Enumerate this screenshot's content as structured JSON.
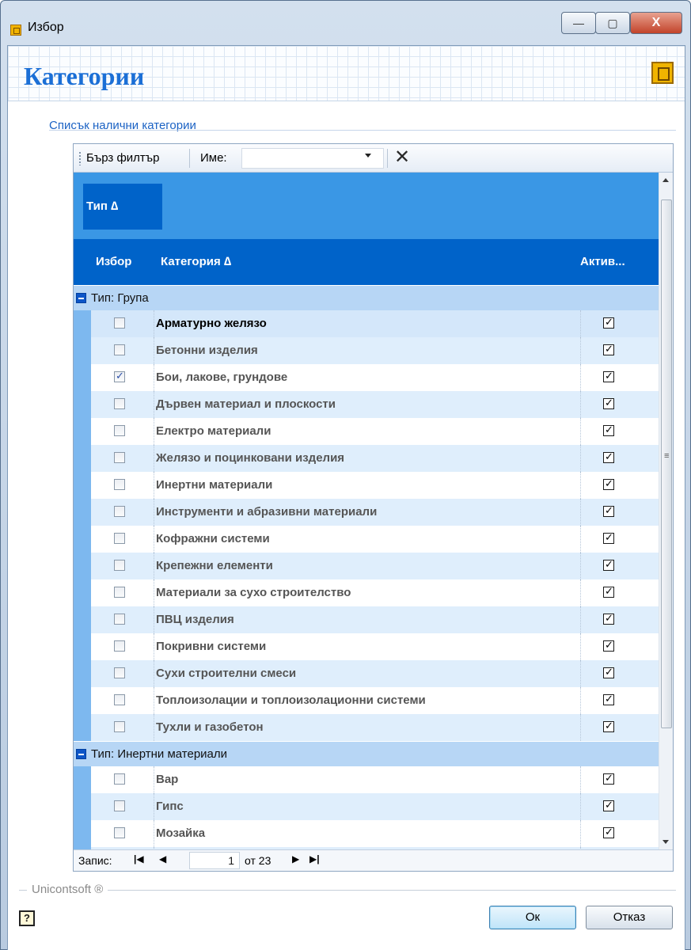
{
  "window": {
    "title": "Избор",
    "min_glyph": "—",
    "max_glyph": "▢",
    "close_glyph": "X"
  },
  "header": {
    "title": "Категории"
  },
  "section": {
    "label": "Списък налични категории"
  },
  "toolbar": {
    "quick_filter": "Бърз филтър",
    "name_label": "Име:",
    "name_value": "",
    "clear_glyph": "✕"
  },
  "grid": {
    "group_by_header": "Тип ∆",
    "columns": {
      "select": "Избор",
      "category": "Категория ∆",
      "active": "Актив..."
    },
    "groups": [
      {
        "label": "Тип: Група",
        "rows": [
          {
            "name": "Арматурно желязо",
            "selected": false,
            "active": true
          },
          {
            "name": "Бетонни изделия",
            "selected": false,
            "active": true
          },
          {
            "name": "Бои, лакове, грундове",
            "selected": true,
            "active": true
          },
          {
            "name": "Дървен материал и плоскости",
            "selected": false,
            "active": true
          },
          {
            "name": "Електро материали",
            "selected": false,
            "active": true
          },
          {
            "name": "Желязо и поцинковани изделия",
            "selected": false,
            "active": true
          },
          {
            "name": "Инертни материали",
            "selected": false,
            "active": true
          },
          {
            "name": "Инструменти и абразивни материали",
            "selected": false,
            "active": true
          },
          {
            "name": "Кофражни системи",
            "selected": false,
            "active": true
          },
          {
            "name": "Крепежни елементи",
            "selected": false,
            "active": true
          },
          {
            "name": "Материали за сухо строителство",
            "selected": false,
            "active": true
          },
          {
            "name": "ПВЦ изделия",
            "selected": false,
            "active": true
          },
          {
            "name": "Покривни системи",
            "selected": false,
            "active": true
          },
          {
            "name": "Сухи строителни смеси",
            "selected": false,
            "active": true
          },
          {
            "name": "Топлоизолации и топлоизолационни системи",
            "selected": false,
            "active": true
          },
          {
            "name": "Тухли и газобетон",
            "selected": false,
            "active": true
          }
        ]
      },
      {
        "label": "Тип: Инертни материали",
        "rows": [
          {
            "name": "Вар",
            "selected": false,
            "active": true
          },
          {
            "name": "Гипс",
            "selected": false,
            "active": true
          },
          {
            "name": "Мозайка",
            "selected": false,
            "active": true
          },
          {
            "name": "",
            "selected": false,
            "active": false
          }
        ]
      }
    ]
  },
  "navigator": {
    "label": "Запис:",
    "current": "1",
    "of_label": "от 23",
    "first_glyph": "|◀",
    "prev_glyph": "◀",
    "next_glyph": "▶",
    "last_glyph": "▶|"
  },
  "footer": {
    "brand": "Unicontsoft ®",
    "help_glyph": "?",
    "ok": "Ок",
    "cancel": "Отказ"
  }
}
